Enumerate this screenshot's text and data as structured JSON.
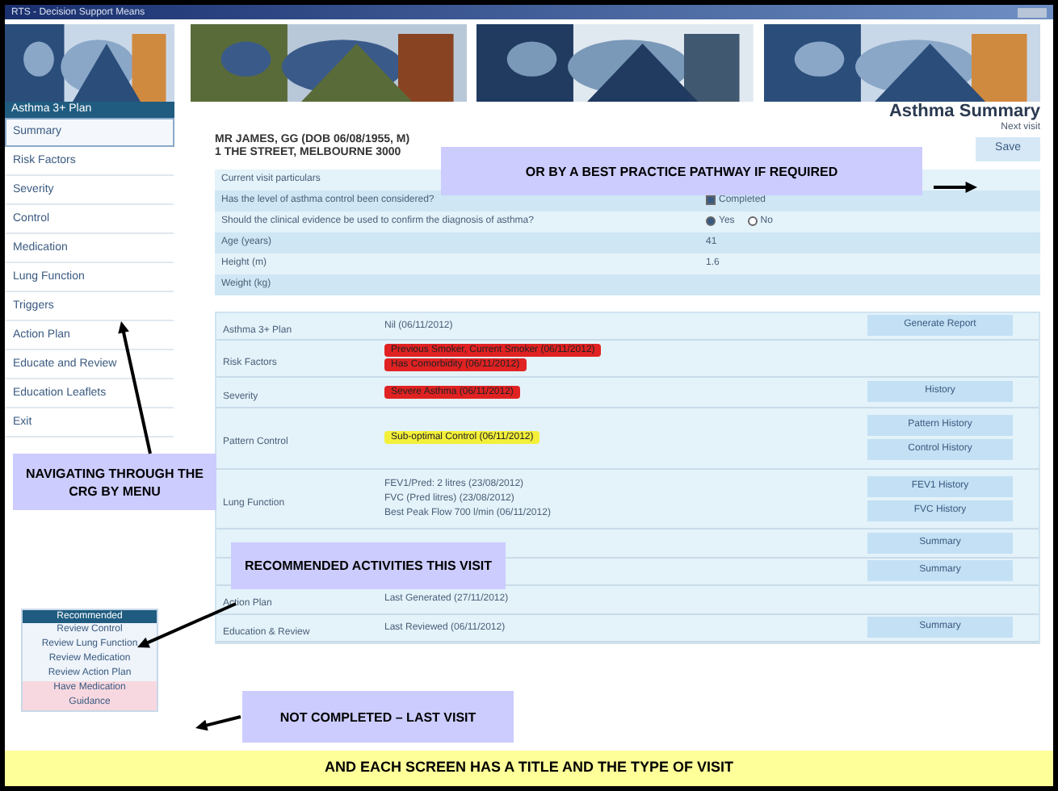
{
  "window": {
    "title": "RTS - Decision Support Means"
  },
  "sidebar": {
    "header": "Asthma 3+ Plan",
    "items": [
      {
        "label": "Summary",
        "selected": true
      },
      {
        "label": "Risk Factors",
        "selected": false
      },
      {
        "label": "Severity",
        "selected": false
      },
      {
        "label": "Control",
        "selected": false
      },
      {
        "label": "Medication",
        "selected": false
      },
      {
        "label": "Lung Function",
        "selected": false
      },
      {
        "label": "Triggers",
        "selected": false
      },
      {
        "label": "Action Plan",
        "selected": false
      },
      {
        "label": "Educate and Review",
        "selected": false
      },
      {
        "label": "Education Leaflets",
        "selected": false
      },
      {
        "label": "Exit",
        "selected": false
      }
    ]
  },
  "page": {
    "title": "Asthma Summary",
    "subtitle": "Next visit",
    "patient": [
      "MR JAMES, GG (DOB 06/08/1955, M)",
      "1 THE STREET, MELBOURNE 3000"
    ],
    "save_button": "Save"
  },
  "particulars": [
    {
      "kind": "text",
      "label": "Current visit particulars"
    },
    {
      "kind": "checkbox",
      "label": "Has the level of asthma control been considered?",
      "value": "Completed",
      "checked": true
    },
    {
      "kind": "radio",
      "label": "Should the clinical evidence be used to confirm the diagnosis of asthma?",
      "options": [
        {
          "label": "Yes",
          "selected": true
        },
        {
          "label": "No",
          "selected": false
        }
      ]
    },
    {
      "kind": "text",
      "label": "Age (years)",
      "value": "41"
    },
    {
      "kind": "text",
      "label": "Height (m)",
      "value": "1.6"
    },
    {
      "kind": "text",
      "label": "Weight (kg)"
    }
  ],
  "summary": [
    {
      "label": "Asthma 3+ Plan",
      "entries": [
        {
          "kind": "text",
          "text": "Nil (06/11/2012)"
        }
      ],
      "buttons": [
        "Generate Report"
      ]
    },
    {
      "label": "Risk Factors",
      "entries": [
        {
          "kind": "badge",
          "color": "#e02222",
          "text": "Previous Smoker, Current Smoker (06/11/2012)"
        },
        {
          "kind": "badge",
          "color": "#e02222",
          "text": "Has Comorbidity (06/11/2012)"
        }
      ]
    },
    {
      "label": "Severity",
      "entries": [
        {
          "kind": "badge",
          "color": "#e02222",
          "text": "Severe Asthma (06/11/2012)"
        }
      ],
      "buttons": [
        "History"
      ]
    },
    {
      "label": "Pattern Control",
      "entries": [
        {
          "kind": "badge",
          "color": "#f4f03a",
          "text": "Sub-optimal Control (06/11/2012)"
        }
      ],
      "buttons": [
        "Pattern History",
        "Control History"
      ]
    },
    {
      "label": "Lung Function",
      "entries": [
        {
          "kind": "text",
          "text": "FEV1/Pred: 2 litres (23/08/2012)"
        },
        {
          "kind": "text",
          "text": "FVC (Pred litres) (23/08/2012)"
        },
        {
          "kind": "text",
          "text": "Best Peak Flow 700 l/min (06/11/2012)"
        }
      ],
      "buttons": [
        "FEV1 History",
        "FVC History"
      ]
    },
    {
      "buttons": [
        "Summary"
      ]
    },
    {
      "buttons": [
        "Summary"
      ]
    },
    {
      "label": "Action Plan",
      "entries": [
        {
          "kind": "text",
          "text": "Last Generated (27/11/2012)"
        }
      ]
    },
    {
      "label": "Education & Review",
      "entries": [
        {
          "kind": "text",
          "text": "Last Reviewed (06/11/2012)"
        }
      ],
      "buttons": [
        "Summary"
      ]
    }
  ],
  "recommended": {
    "header": "Recommended",
    "items": [
      {
        "label": "Review Control",
        "completed": true
      },
      {
        "label": "Review Lung Function",
        "completed": true
      },
      {
        "label": "Review Medication",
        "completed": true
      },
      {
        "label": "Review Action Plan",
        "completed": true
      },
      {
        "label": "Have Medication",
        "completed": false
      },
      {
        "label": "Guidance",
        "completed": false
      }
    ]
  },
  "callouts": [
    {
      "text": "OR BY A BEST PRACTICE PATHWAY IF REQUIRED"
    },
    {
      "text": "NAVIGATING THROUGH THE CRG BY MENU"
    },
    {
      "text": "RECOMMENDED ACTIVITIES THIS VISIT"
    },
    {
      "text": "NOT COMPLETED – LAST VISIT"
    }
  ],
  "footer": "AND EACH SCREEN HAS A TITLE AND THE TYPE OF VISIT"
}
